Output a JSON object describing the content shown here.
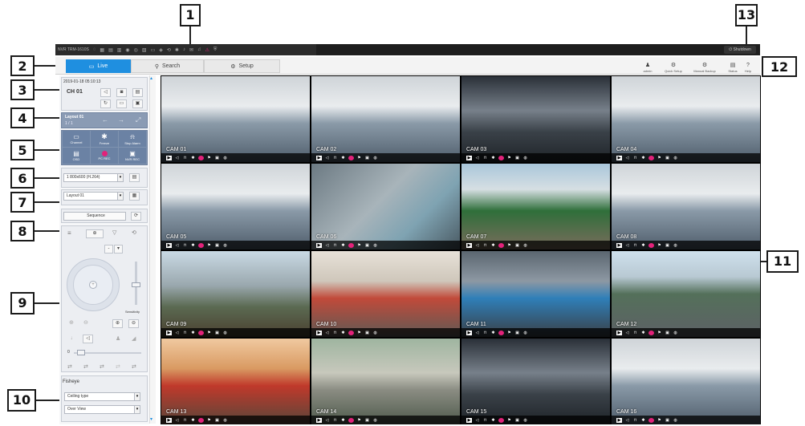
{
  "callouts": [
    "1",
    "2",
    "3",
    "4",
    "5",
    "6",
    "7",
    "8",
    "9",
    "10",
    "11",
    "12",
    "13"
  ],
  "titlebar": {
    "app_name": "NVR TRM-1610S",
    "shutdown_label": "Shutdown"
  },
  "tabs": [
    {
      "label": "Live",
      "icon": "monitor-icon"
    },
    {
      "label": "Search",
      "icon": "search-icon"
    },
    {
      "label": "Setup",
      "icon": "gear-icon"
    }
  ],
  "toolbar_right": [
    {
      "label": "admin",
      "icon": "user-icon"
    },
    {
      "label": "Quick Setup",
      "icon": "gear-icon"
    },
    {
      "label": "Manual Backup",
      "icon": "gear-icon"
    },
    {
      "label": "Status",
      "icon": "status-icon"
    },
    {
      "label": "Help",
      "icon": "help-icon"
    }
  ],
  "info": {
    "datetime": "2019-01-18  05:10:13",
    "channel": "CH 01"
  },
  "layout": {
    "name": "Layout 01",
    "page": "1 / 1"
  },
  "record_buttons": [
    {
      "label": "Channel"
    },
    {
      "label": "Freeze"
    },
    {
      "label": "Stop Alarm"
    },
    {
      "label": "OSD"
    },
    {
      "label": "PC REC"
    },
    {
      "label": "NVR REC"
    }
  ],
  "profile_select": "1 800x600 (H.264)",
  "layout_select": "Layout 01",
  "sequence_label": "Sequence",
  "ptz": {
    "sensitivity_label": "Sensitivity",
    "slider_value_label": "0"
  },
  "fisheye": {
    "title": "Fisheye",
    "mount_type": "Ceiling type",
    "view_mode": "Over View"
  },
  "cameras": [
    {
      "name": "CAM 01",
      "scene": "train-interior"
    },
    {
      "name": "CAM 02",
      "scene": "train-interior"
    },
    {
      "name": "CAM 03",
      "scene": "tunnel"
    },
    {
      "name": "CAM 04",
      "scene": "train-interior"
    },
    {
      "name": "CAM 05",
      "scene": "train-interior"
    },
    {
      "name": "CAM 06",
      "scene": "exit-sign"
    },
    {
      "name": "CAM 07",
      "scene": "station"
    },
    {
      "name": "CAM 08",
      "scene": "train-interior"
    },
    {
      "name": "CAM 09",
      "scene": "bridge"
    },
    {
      "name": "CAM 10",
      "scene": "bus-depot"
    },
    {
      "name": "CAM 11",
      "scene": "metro-platform"
    },
    {
      "name": "CAM 12",
      "scene": "highway"
    },
    {
      "name": "CAM 13",
      "scene": "train-outdoor"
    },
    {
      "name": "CAM 14",
      "scene": "intersection"
    },
    {
      "name": "CAM 15",
      "scene": "tunnel"
    },
    {
      "name": "CAM 16",
      "scene": "train-interior"
    }
  ],
  "colors": {
    "accent": "#1f8fe0",
    "rec": "#e2227a",
    "panel": "#eceef2",
    "panel_dark": "#8a9bb4"
  }
}
